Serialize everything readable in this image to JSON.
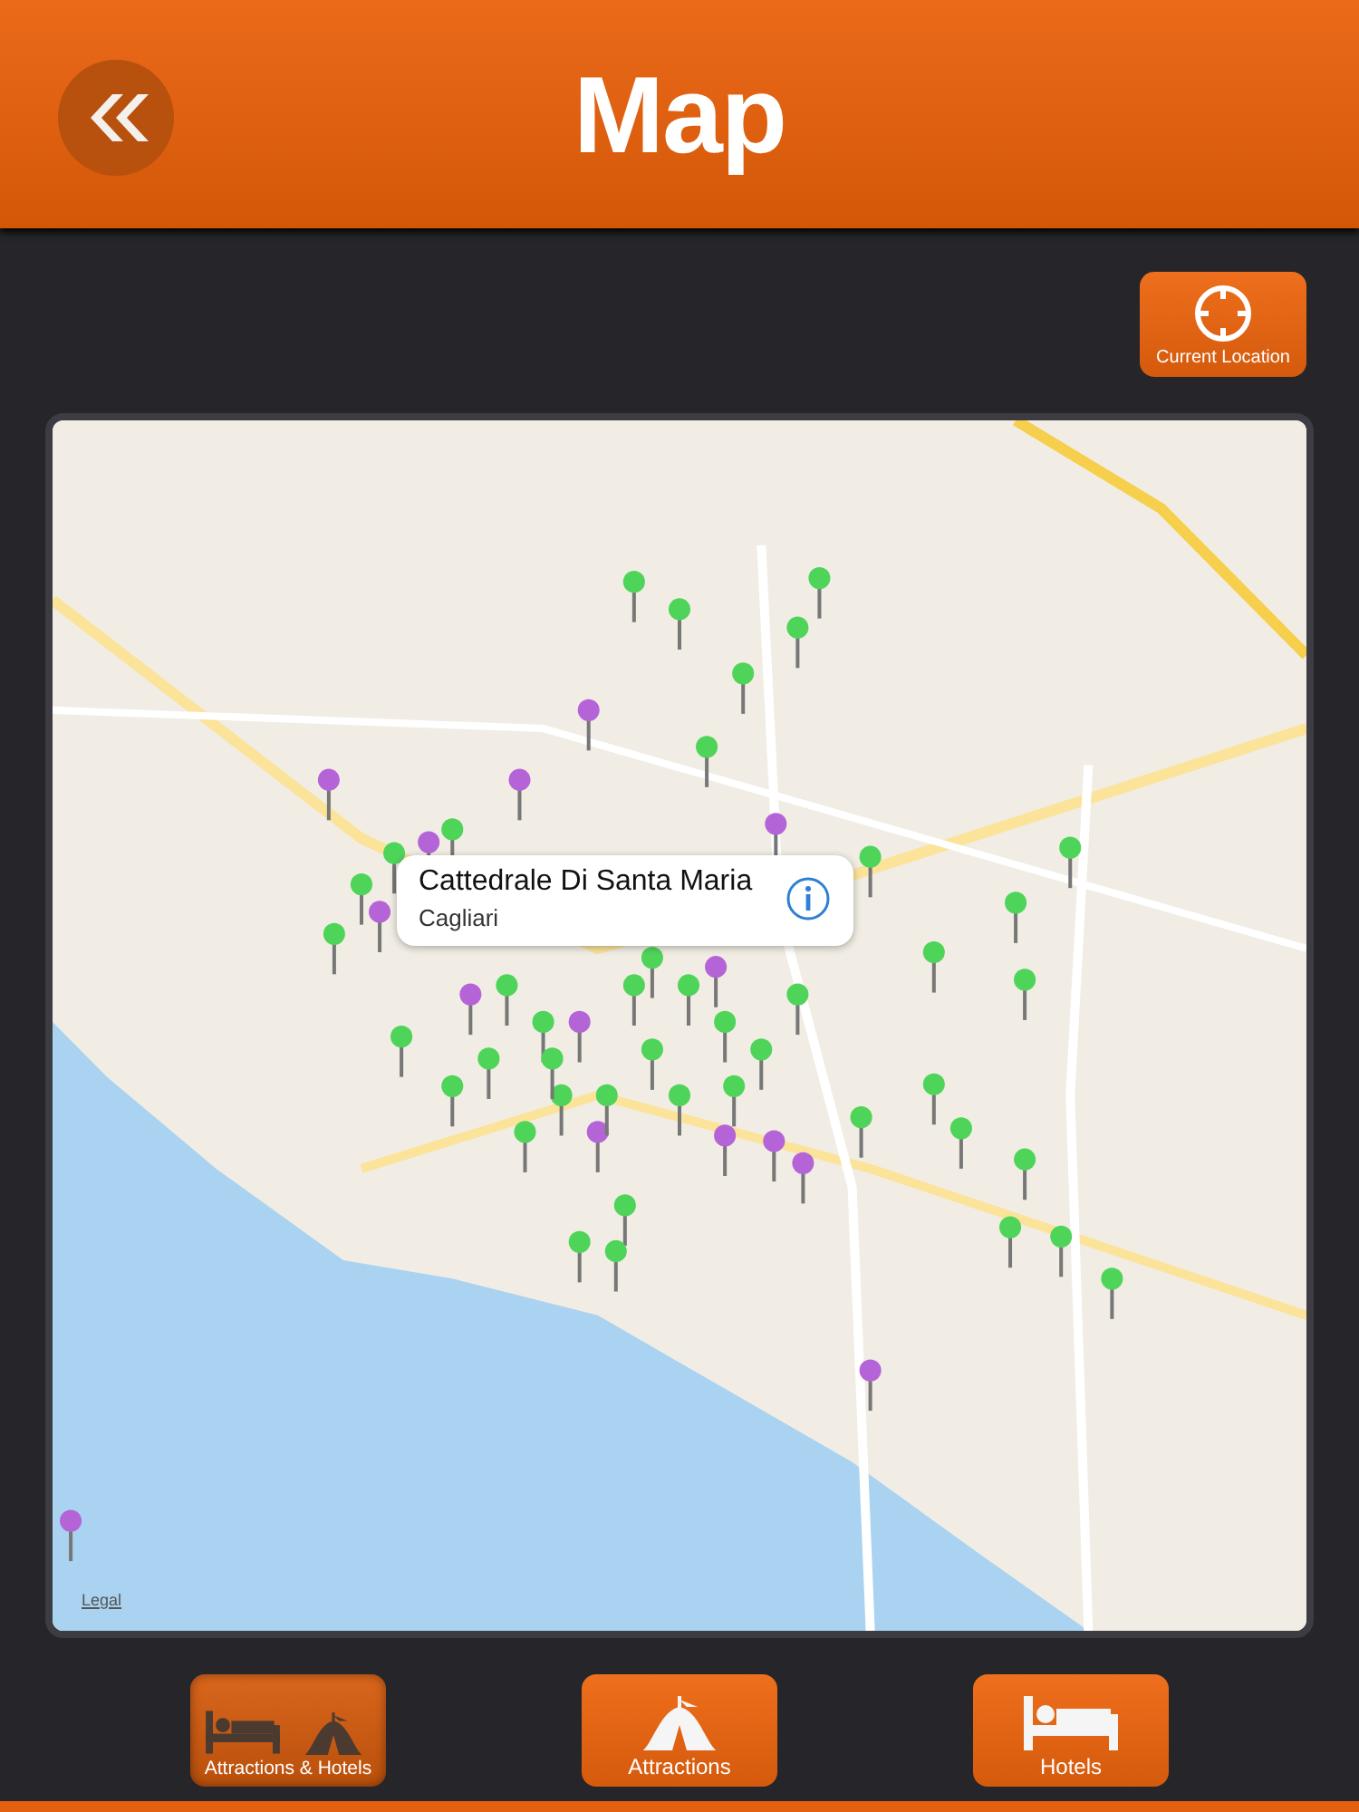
{
  "header": {
    "title": "Map"
  },
  "current_location": {
    "label": "Current Location"
  },
  "map": {
    "callout": {
      "title": "Cattedrale Di Santa Maria",
      "subtitle": "Cagliari"
    },
    "legal_link": "Legal"
  },
  "tabs": [
    {
      "label": "Attractions & Hotels",
      "kind": "both",
      "selected": true
    },
    {
      "label": "Attractions",
      "kind": "attractions",
      "selected": false
    },
    {
      "label": "Hotels",
      "kind": "hotels",
      "selected": false
    }
  ]
}
